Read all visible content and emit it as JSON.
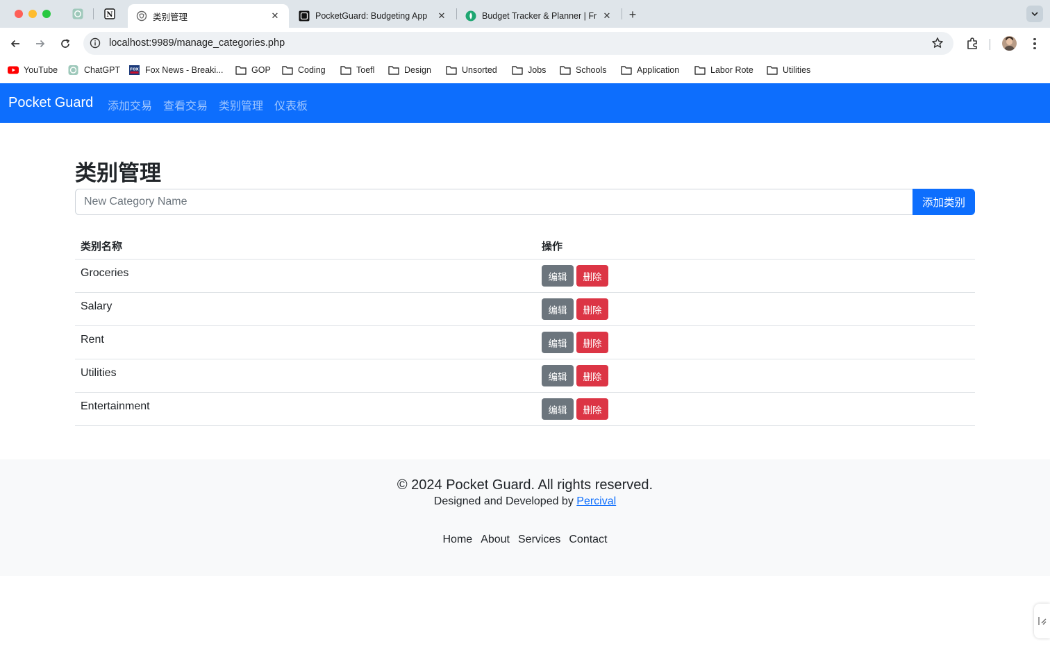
{
  "browser": {
    "tabs": [
      {
        "title": "类别管理",
        "active": true
      },
      {
        "title": "PocketGuard: Budgeting App",
        "active": false
      },
      {
        "title": "Budget Tracker & Planner | Fr",
        "active": false
      }
    ],
    "close_glyph": "✕",
    "new_tab_glyph": "+",
    "url": "localhost:9989/manage_categories.php",
    "bookmarks": [
      {
        "label": "YouTube",
        "icon": "youtube-icon"
      },
      {
        "label": "ChatGPT",
        "icon": "chatgpt-icon"
      },
      {
        "label": "Fox News - Breaki...",
        "icon": "foxnews-icon"
      },
      {
        "label": "GOP",
        "icon": "folder-icon"
      },
      {
        "label": "Coding",
        "icon": "folder-icon"
      },
      {
        "label": "Toefl",
        "icon": "folder-icon"
      },
      {
        "label": "Design",
        "icon": "folder-icon"
      },
      {
        "label": "Unsorted",
        "icon": "folder-icon"
      },
      {
        "label": "Jobs",
        "icon": "folder-icon"
      },
      {
        "label": "Schools",
        "icon": "folder-icon"
      },
      {
        "label": "Application",
        "icon": "folder-icon"
      },
      {
        "label": "Labor Rote",
        "icon": "folder-icon"
      },
      {
        "label": "Utilities",
        "icon": "folder-icon"
      }
    ]
  },
  "navbar": {
    "brand": "Pocket Guard",
    "links": [
      "添加交易",
      "查看交易",
      "类别管理",
      "仪表板"
    ]
  },
  "main": {
    "title": "类别管理",
    "input_placeholder": "New Category Name",
    "add_button": "添加类别",
    "table": {
      "headers": [
        "类别名称",
        "操作"
      ],
      "rows": [
        {
          "name": "Groceries",
          "edit": "编辑",
          "delete": "删除"
        },
        {
          "name": "Salary",
          "edit": "编辑",
          "delete": "删除"
        },
        {
          "name": "Rent",
          "edit": "编辑",
          "delete": "删除"
        },
        {
          "name": "Utilities",
          "edit": "编辑",
          "delete": "删除"
        },
        {
          "name": "Entertainment",
          "edit": "编辑",
          "delete": "删除"
        }
      ]
    }
  },
  "footer": {
    "copyright": "© 2024 Pocket Guard. All rights reserved.",
    "designed_prefix": "Designed and Developed by ",
    "designer_link": "Percival",
    "links": [
      "Home",
      "About",
      "Services",
      "Contact"
    ]
  },
  "colors": {
    "primary": "#0d6efd",
    "secondary": "#6c757d",
    "danger": "#dc3545",
    "footer_bg": "#f8f9fa"
  }
}
